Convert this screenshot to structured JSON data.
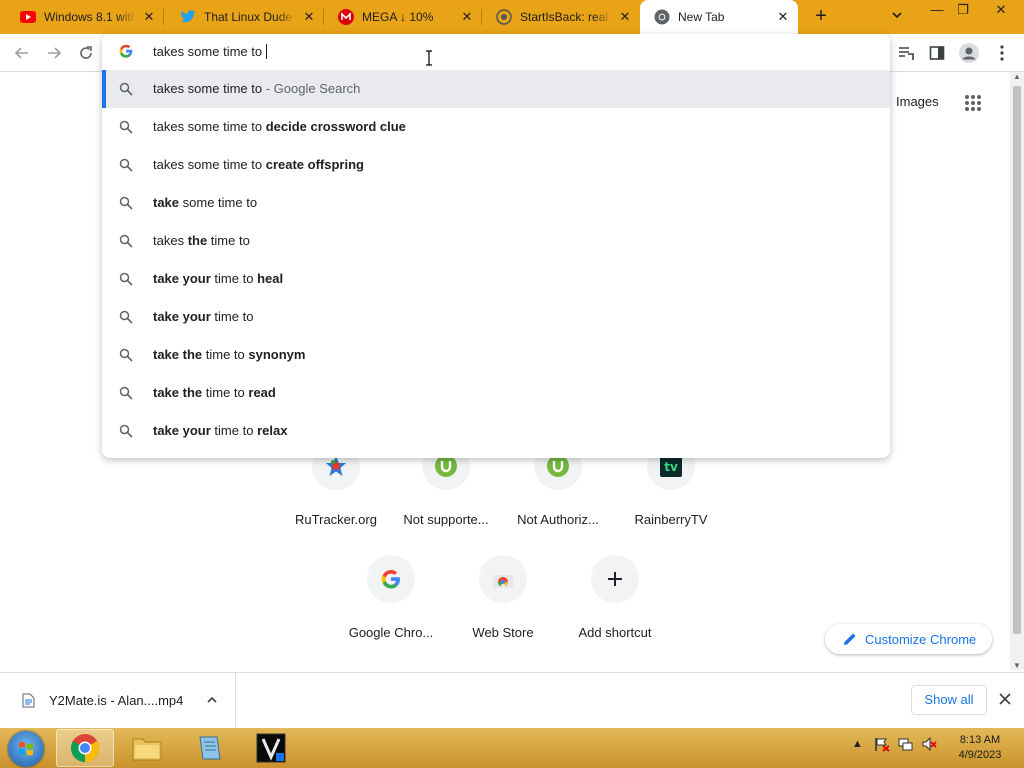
{
  "tabs": [
    {
      "title": "Windows 8.1 with",
      "icon": "youtube-icon"
    },
    {
      "title": "That Linux Dude",
      "icon": "twitter-icon"
    },
    {
      "title": "MEGA ↓ 10%",
      "icon": "mega-icon"
    },
    {
      "title": "StartIsBack: real s",
      "icon": "startisback-icon"
    },
    {
      "title": "New Tab",
      "icon": "chrome-icon",
      "active": true
    }
  ],
  "omnibox": {
    "query": "takes some time to",
    "suggestions": [
      {
        "parts": [
          {
            "t": "takes some time to",
            "b": false
          }
        ],
        "desc": " - Google Search",
        "selected": true
      },
      {
        "parts": [
          {
            "t": "takes some time to ",
            "b": false
          },
          {
            "t": "decide crossword clue",
            "b": true
          }
        ]
      },
      {
        "parts": [
          {
            "t": "takes some time to ",
            "b": false
          },
          {
            "t": "create offspring",
            "b": true
          }
        ]
      },
      {
        "parts": [
          {
            "t": "take",
            "b": true
          },
          {
            "t": " some time to",
            "b": false
          }
        ]
      },
      {
        "parts": [
          {
            "t": "takes ",
            "b": false
          },
          {
            "t": "the",
            "b": true
          },
          {
            "t": " time to",
            "b": false
          }
        ]
      },
      {
        "parts": [
          {
            "t": "take your",
            "b": true
          },
          {
            "t": " time to ",
            "b": false
          },
          {
            "t": "heal",
            "b": true
          }
        ]
      },
      {
        "parts": [
          {
            "t": "take your",
            "b": true
          },
          {
            "t": " time to",
            "b": false
          }
        ]
      },
      {
        "parts": [
          {
            "t": "take the",
            "b": true
          },
          {
            "t": " time to ",
            "b": false
          },
          {
            "t": "synonym",
            "b": true
          }
        ]
      },
      {
        "parts": [
          {
            "t": "take the",
            "b": true
          },
          {
            "t": " time to ",
            "b": false
          },
          {
            "t": "read",
            "b": true
          }
        ]
      },
      {
        "parts": [
          {
            "t": "take your",
            "b": true
          },
          {
            "t": " time to ",
            "b": false
          },
          {
            "t": "relax",
            "b": true
          }
        ]
      }
    ]
  },
  "page": {
    "images_link": "Images",
    "shortcuts_row1": [
      {
        "label": "RuTracker.org",
        "icon": "rutracker-icon"
      },
      {
        "label": "Not supporte...",
        "icon": "utorrent-icon"
      },
      {
        "label": "Not Authoriz...",
        "icon": "utorrent-icon"
      },
      {
        "label": "RainberryTV",
        "icon": "rainberrytv-icon"
      }
    ],
    "shortcuts_row2": [
      {
        "label": "Google Chro...",
        "icon": "google-icon"
      },
      {
        "label": "Web Store",
        "icon": "webstore-icon"
      },
      {
        "label": "Add shortcut",
        "icon": "plus-icon"
      }
    ],
    "customize_label": "Customize Chrome"
  },
  "downloads": {
    "file_name": "Y2Mate.is - Alan....mp4",
    "show_all": "Show all"
  },
  "taskbar": {
    "time": "8:13 AM",
    "date": "4/9/2023"
  },
  "colors": {
    "tabstrip": "#e8a316",
    "accent_blue": "#1a73e8",
    "taskbar": "#d8a843"
  }
}
